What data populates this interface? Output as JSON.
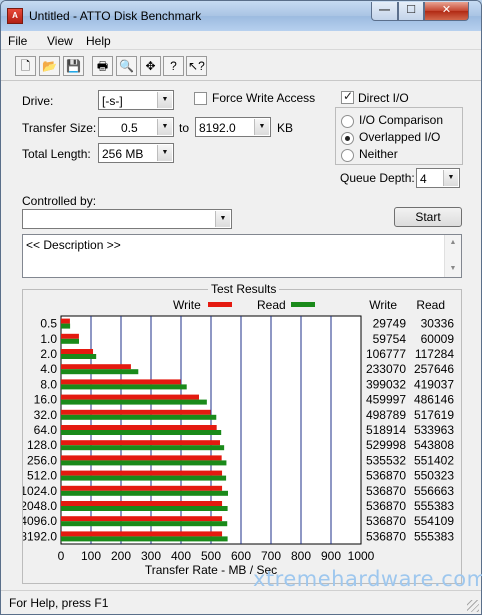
{
  "window": {
    "title": "Untitled - ATTO Disk Benchmark",
    "app_icon": "atto-app-icon",
    "buttons": {
      "minimize": "—",
      "maximize": "☐",
      "close": "✕"
    }
  },
  "menu": [
    "File",
    "View",
    "Help"
  ],
  "toolbar": [
    {
      "name": "new-file-icon",
      "glyph": "🗋"
    },
    {
      "name": "open-folder-icon",
      "glyph": "📂"
    },
    {
      "name": "save-icon",
      "glyph": "💾"
    },
    {
      "name": "print-icon",
      "glyph": "🖶"
    },
    {
      "name": "print-preview-icon",
      "glyph": "🔍"
    },
    {
      "name": "move-icon",
      "glyph": "✥"
    },
    {
      "name": "help-icon",
      "glyph": "?"
    },
    {
      "name": "context-help-icon",
      "glyph": "↖?"
    }
  ],
  "settings": {
    "drive_label": "Drive:",
    "drive_value": "[-s-]",
    "force_write_label": "Force Write Access",
    "force_write_checked": false,
    "direct_io_label": "Direct I/O",
    "direct_io_checked": true,
    "transfer_size_label": "Transfer Size:",
    "transfer_from": "0.5",
    "transfer_to_label": "to",
    "transfer_to": "8192.0",
    "transfer_unit": "KB",
    "total_length_label": "Total Length:",
    "total_length_value": "256 MB",
    "io_options": [
      {
        "label": "I/O Comparison",
        "selected": false
      },
      {
        "label": "Overlapped I/O",
        "selected": true
      },
      {
        "label": "Neither",
        "selected": false
      }
    ],
    "queue_depth_label": "Queue Depth:",
    "queue_depth_value": "4",
    "controlled_by_label": "Controlled by:",
    "controlled_by_value": "",
    "start_label": "Start",
    "description_text": "<< Description >>"
  },
  "chart_data": {
    "type": "bar",
    "title": "Test Results",
    "xlabel": "Transfer Rate - MB / Sec",
    "xlim": [
      0,
      1000
    ],
    "x_ticks": [
      "0",
      "100",
      "200",
      "300",
      "400",
      "500",
      "600",
      "700",
      "800",
      "900",
      "1000"
    ],
    "grid": true,
    "categories": [
      "0.5",
      "1.0",
      "2.0",
      "4.0",
      "8.0",
      "16.0",
      "32.0",
      "64.0",
      "128.0",
      "256.0",
      "512.0",
      "1024.0",
      "2048.0",
      "4096.0",
      "8192.0"
    ],
    "series": [
      {
        "name": "Write",
        "color": "#e41a10",
        "values": [
          29.749,
          59.754,
          106.777,
          233.07,
          399.032,
          459.997,
          498.789,
          518.914,
          529.998,
          535.532,
          536.87,
          536.87,
          536.87,
          536.87,
          536.87
        ]
      },
      {
        "name": "Read",
        "color": "#1a8a1a",
        "values": [
          30.336,
          60.009,
          117.284,
          257.646,
          419.037,
          486.146,
          517.619,
          533.963,
          543.808,
          551.402,
          550.323,
          556.663,
          555.383,
          554.109,
          555.383
        ]
      }
    ],
    "table_headers": {
      "write": "Write",
      "read": "Read"
    },
    "write_kb": [
      "29749",
      "59754",
      "106777",
      "233070",
      "399032",
      "459997",
      "498789",
      "518914",
      "529998",
      "535532",
      "536870",
      "536870",
      "536870",
      "536870",
      "536870"
    ],
    "read_kb": [
      "30336",
      "60009",
      "117284",
      "257646",
      "419037",
      "486146",
      "517619",
      "533963",
      "543808",
      "551402",
      "550323",
      "556663",
      "555383",
      "554109",
      "555383"
    ]
  },
  "status": {
    "text": "For Help, press F1"
  },
  "watermark": "xtremehardware.com"
}
